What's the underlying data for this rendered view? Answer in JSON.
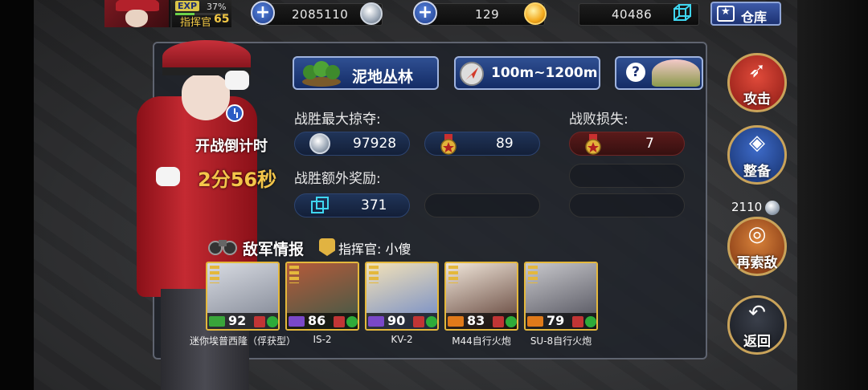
{
  "topbar": {
    "exp_tag": "EXP",
    "exp_percent": "37%",
    "exp_fraction": 0.37,
    "rank_label": "指挥官",
    "rank_level": "65",
    "silver": "2085110",
    "gold": "129",
    "cubes": "40486",
    "warehouse_label": "仓库"
  },
  "battle": {
    "terrain_label": "泥地丛林",
    "range_label": "100m~1200m",
    "help_icon": "?",
    "countdown_title": "开战倒计时",
    "countdown_value": "2分56秒",
    "max_plunder_label": "战胜最大掠夺:",
    "plunder_silver": "97928",
    "plunder_medals": "89",
    "loss_label": "战败损失:",
    "loss_medals": "7",
    "bonus_label": "战胜额外奖励:",
    "bonus_cubes": "371"
  },
  "enemy": {
    "title": "敌军情报",
    "commander": "指挥官: 小傻",
    "units": [
      {
        "name": "迷你埃普西隆（俘获型）",
        "level": "92",
        "class_color": "#3aa53a"
      },
      {
        "name": "IS-2",
        "level": "86",
        "class_color": "#7a48c8"
      },
      {
        "name": "KV-2",
        "level": "90",
        "class_color": "#7a48c8"
      },
      {
        "name": "M44自行火炮",
        "level": "83",
        "class_color": "#e07a1a"
      },
      {
        "name": "SU-8自行火炮",
        "level": "79",
        "class_color": "#e07a1a"
      }
    ]
  },
  "side_buttons": {
    "attack": "攻击",
    "equip": "整备",
    "research_cost": "2110",
    "research": "再索敌",
    "back": "返回"
  },
  "colors": {
    "accent_gold": "#f4c64a",
    "button_blue": "#1d3272",
    "attack_red": "#c0322a"
  }
}
